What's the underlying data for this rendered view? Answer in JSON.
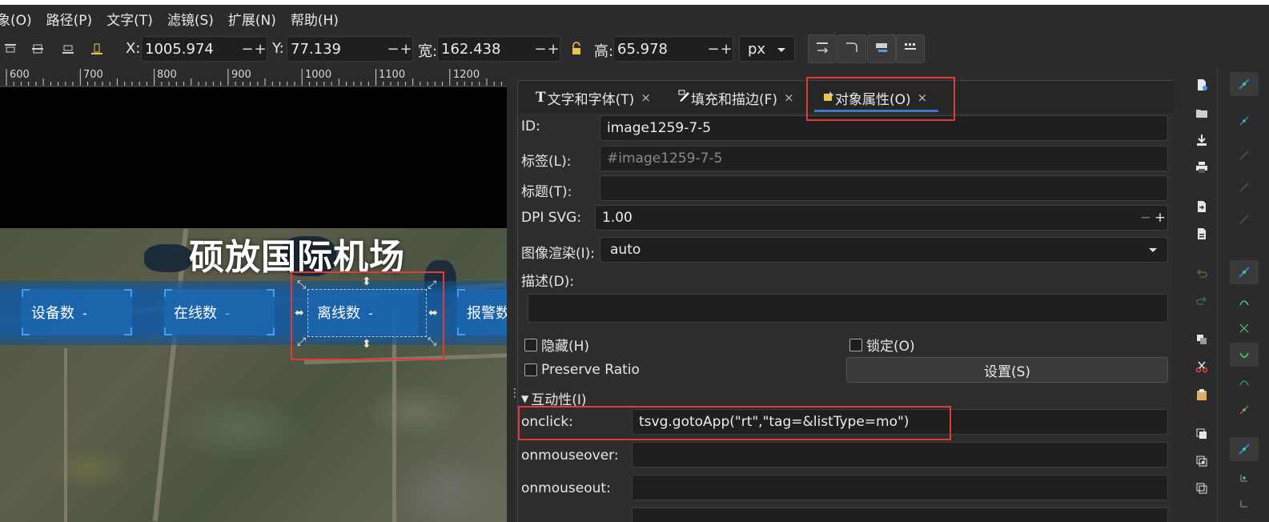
{
  "menu": [
    "象(O)",
    "路径(P)",
    "文字(T)",
    "滤镜(S)",
    "扩展(N)",
    "帮助(H)"
  ],
  "toolbar": {
    "x_label": "X:",
    "x_value": "1005.974",
    "y_label": "Y:",
    "y_value": "77.139",
    "w_label": "宽:",
    "w_value": "162.438",
    "h_label": "高:",
    "h_value": "65.978",
    "minus": "−",
    "plus": "+",
    "unit": "px"
  },
  "ruler": [
    "600",
    "700",
    "800",
    "900",
    "1000",
    "1100",
    "1200"
  ],
  "canvas": {
    "title": "硕放国际机场",
    "cards": [
      {
        "label": "设备数",
        "value": "-"
      },
      {
        "label": "在线数",
        "value": "-"
      },
      {
        "label": "离线数",
        "value": "-"
      },
      {
        "label": "报警数",
        "value": ""
      }
    ]
  },
  "dialog": {
    "tabs": [
      {
        "label": "文字和字体(T)",
        "close": "×"
      },
      {
        "label": "填充和描边(F)",
        "close": "×"
      },
      {
        "label": "对象属性(O)",
        "close": "×"
      }
    ],
    "id_label": "ID:",
    "id_value": "image1259-7-5",
    "tag_label": "标签(L):",
    "tag_placeholder": "#image1259-7-5",
    "title_label": "标题(T):",
    "title_value": "",
    "dpi_label": "DPI SVG:",
    "dpi_value": "1.00",
    "render_label": "图像渲染(I):",
    "render_value": "auto",
    "desc_label": "描述(D):",
    "desc_value": "",
    "hide_label": "隐藏(H)",
    "lock_label": "锁定(O)",
    "ratio_label": "Preserve Ratio",
    "set_button": "设置(S)",
    "interactivity_label": "互动性(I)",
    "onclick_label": "onclick:",
    "onclick_value": "tsvg.gotoApp(\"rt\",\"tag=&listType=mo\")",
    "onmouseover_label": "onmouseover:",
    "onmouseout_label": "onmouseout:"
  },
  "colors": {
    "highlight_red": "#e23a3a",
    "tab_accent": "#3d75c9",
    "panel_bg": "#2d2d2d",
    "field_bg": "#1f1f1f"
  }
}
